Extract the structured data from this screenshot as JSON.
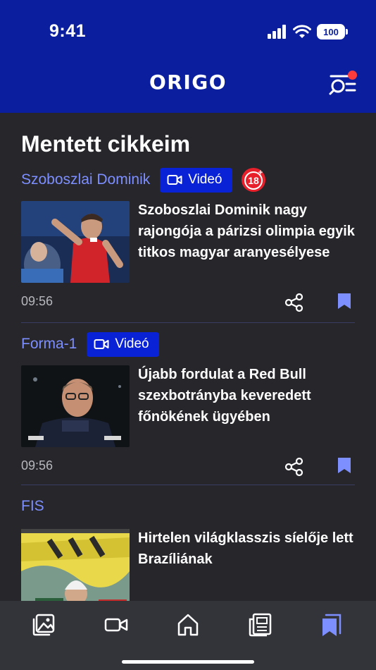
{
  "status_bar": {
    "time": "9:41",
    "battery": "100"
  },
  "header": {
    "logo": "ORIGO"
  },
  "page": {
    "title": "Mentett cikkeim"
  },
  "articles": [
    {
      "category": "Szoboszlai Dominik",
      "video_label": "Videó",
      "age_rating": "18",
      "headline": "Szoboszlai Dominik nagy rajongója a párizsi olimpia egyik titkos magyar aranyesélyese",
      "time": "09:56"
    },
    {
      "category": "Forma-1",
      "video_label": "Videó",
      "headline": "Újabb fordulat a Red Bull szexbotrányba keveredett főnökének ügyében",
      "time": "09:56"
    },
    {
      "category": "FIS",
      "headline": "Hirtelen világklasszis síelője lett Brazíliának"
    }
  ],
  "tabbar": {
    "items": [
      "gallery-icon",
      "video-icon",
      "home-icon",
      "newspaper-icon",
      "bookmarks-icon"
    ],
    "active": "bookmarks-icon"
  },
  "colors": {
    "header_bg": "#0b1f9e",
    "page_bg": "#26262b",
    "accent": "#7d8fff",
    "video_badge": "#0a22d6",
    "notification": "#ff3b3b"
  }
}
